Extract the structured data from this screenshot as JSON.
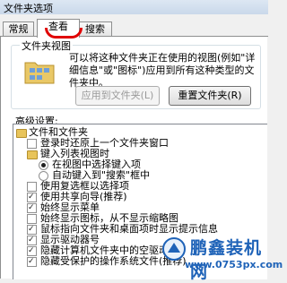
{
  "window": {
    "title": "文件夹选项"
  },
  "tabs": [
    {
      "label": "常规"
    },
    {
      "label": "查看"
    },
    {
      "label": "搜索"
    }
  ],
  "folder_views": {
    "group_label": "文件夹视图",
    "description": "可以将这种文件夹正在使用的视图(例如\"详细信息\"或\"图标\")应用到所有这种类型的文件夹中。",
    "apply_button": "应用到文件夹(L)",
    "reset_button": "重置文件夹(R)"
  },
  "advanced": {
    "label": "高级设置:",
    "items": [
      {
        "text": "文件和文件夹",
        "type": "folder",
        "checked": null
      },
      {
        "text": "登录时还原上一个文件夹窗口",
        "type": "checkbox",
        "checked": false
      },
      {
        "text": "键入列表视图时",
        "type": "folder",
        "checked": null
      },
      {
        "text": "在视图中选择键入项",
        "type": "radio",
        "checked": true
      },
      {
        "text": "自动键入到\"搜索\"框中",
        "type": "radio",
        "checked": false
      },
      {
        "text": "使用复选框以选择项",
        "type": "checkbox",
        "checked": false
      },
      {
        "text": "使用共享向导(推荐)",
        "type": "checkbox",
        "checked": true
      },
      {
        "text": "始终显示菜单",
        "type": "checkbox",
        "checked": true
      },
      {
        "text": "始终显示图标，从不显示缩略图",
        "type": "checkbox",
        "checked": false
      },
      {
        "text": "鼠标指向文件夹和桌面项时显示提示信息",
        "type": "checkbox",
        "checked": true
      },
      {
        "text": "显示驱动器号",
        "type": "checkbox",
        "checked": true
      },
      {
        "text": "隐藏计算机文件夹中的空驱动器",
        "type": "checkbox",
        "checked": true
      },
      {
        "text": "隐藏受保护的操作系统文件(推荐)",
        "type": "checkbox",
        "checked": true
      }
    ]
  },
  "watermark": {
    "name": "鹏鑫装机网",
    "url": "www.0753px.com"
  },
  "colors": {
    "highlight_mark": "#e00000",
    "watermark_blue": "#1f63b8"
  }
}
